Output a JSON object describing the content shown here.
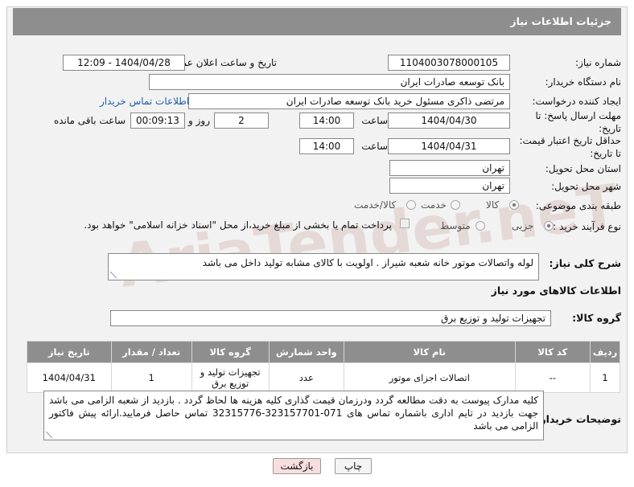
{
  "header": {
    "title": "جزئیات اطلاعات نیاز"
  },
  "fields": {
    "need_number_label": "شماره نیاز:",
    "need_number": "1104003078000105",
    "announce_label": "تاریخ و ساعت اعلان عمومی:",
    "announce_value": "1404/04/28 - 12:09",
    "buyer_org_label": "نام دستگاه خریدار:",
    "buyer_org": "بانک توسعه صادرات ایران",
    "requester_label": "ایجاد کننده درخواست:",
    "requester": "مرتضی ذاکری مسئول خرید بانک توسعه صادرات ایران",
    "contact_link": "اطلاعات تماس خریدار",
    "reply_deadline_label": "مهلت ارسال پاسخ: تا تاریخ:",
    "reply_date": "1404/04/30",
    "time_label": "ساعت",
    "reply_time": "14:00",
    "days_value": "2",
    "days_label": "روز و",
    "remaining_time": "00:09:13",
    "remaining_label": "ساعت باقی مانده",
    "price_validity_label": "حداقل تاریخ اعتبار قیمت: تا تاریخ:",
    "price_date": "1404/04/31",
    "price_time": "14:00",
    "province_label": "استان محل تحویل:",
    "province": "تهران",
    "city_label": "شهر محل تحویل:",
    "city": "تهران",
    "category_label": "طبقه بندی موضوعی:",
    "category_options": [
      "کالا",
      "خدمت",
      "کالا/خدمت"
    ],
    "category_selected": "کالا",
    "process_label": "نوع فرآیند خرید :",
    "process_options": [
      "جزیی",
      "متوسط"
    ],
    "process_selected": "جزیی",
    "payment_note": "پرداخت تمام یا بخشی از مبلغ خرید،از محل \"اسناد خزانه اسلامی\" خواهد بود."
  },
  "summary": {
    "label": "شرح کلی نیاز:",
    "text": "لوله واتصالات موتور خانه شعبه شیراز . اولویت با کالای مشابه تولید داخل می باشد"
  },
  "goods": {
    "section_title": "اطلاعات کالاهای مورد نیاز",
    "group_label": "گروه کالا:",
    "group_value": "تجهیزات تولید و توزیع برق",
    "columns": [
      "ردیف",
      "کد کالا",
      "نام کالا",
      "واحد شمارش",
      "گروه کالا",
      "تعداد / مقدار",
      "تاریخ نیاز"
    ],
    "rows": [
      {
        "row": "1",
        "code": "--",
        "name": "اتصالات اجزای موتور",
        "unit": "عدد",
        "group": "تجهیزات تولید و توزیع برق",
        "qty": "1",
        "date": "1404/04/31"
      }
    ]
  },
  "buyer_notes": {
    "label": "توضیحات خریدار:",
    "text": "کلیه مدارک پیوست به دقت مطالعه گردد ودرزمان قیمت گذاری کلیه هزینه ها لحاظ گردد . بازدید از شعبه الزامی می باشد جهت بازدید در تایم اداری باشماره تماس های 071-323157701-32315776 تماس حاصل فرمایید.ارائه پیش فاکتور الزامی می باشد"
  },
  "buttons": {
    "print": "چاپ",
    "back": "بازگشت"
  },
  "watermark": "AriaTender.neT",
  "colors": {
    "header_bg": "#8e8e8e",
    "link": "#1a5fa8",
    "back_button_bg": "#f9dede"
  }
}
